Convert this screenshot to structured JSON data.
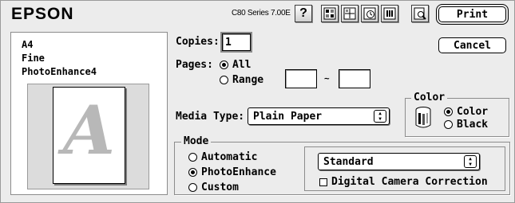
{
  "header": {
    "brand": "EPSON",
    "version": "C80 Series 7.00E",
    "toolbar_icons": [
      "help-icon",
      "layout-icon",
      "watermark-icon",
      "background-printing-icon",
      "utility-icon",
      "preview-icon"
    ],
    "help_glyph": "?"
  },
  "actions": {
    "print_label": "Print",
    "cancel_label": "Cancel"
  },
  "summary": {
    "paper_size": "A4",
    "quality": "Fine",
    "enhance": "PhotoEnhance4",
    "preview_glyph": "A"
  },
  "copies": {
    "label": "Copies:",
    "value": "1"
  },
  "pages": {
    "label": "Pages:",
    "all_label": "All",
    "range_label": "Range",
    "separator": "~",
    "from_value": "",
    "to_value": ""
  },
  "media_type": {
    "label": "Media Type:",
    "selected": "Plain Paper"
  },
  "color": {
    "title": "Color",
    "options": [
      "Color",
      "Black"
    ],
    "selected": "Color"
  },
  "mode": {
    "title": "Mode",
    "options": [
      "Automatic",
      "PhotoEnhance",
      "Custom"
    ],
    "selected": "PhotoEnhance",
    "setting_selected": "Standard",
    "digital_camera_label": "Digital Camera Correction",
    "digital_camera_checked": false
  }
}
